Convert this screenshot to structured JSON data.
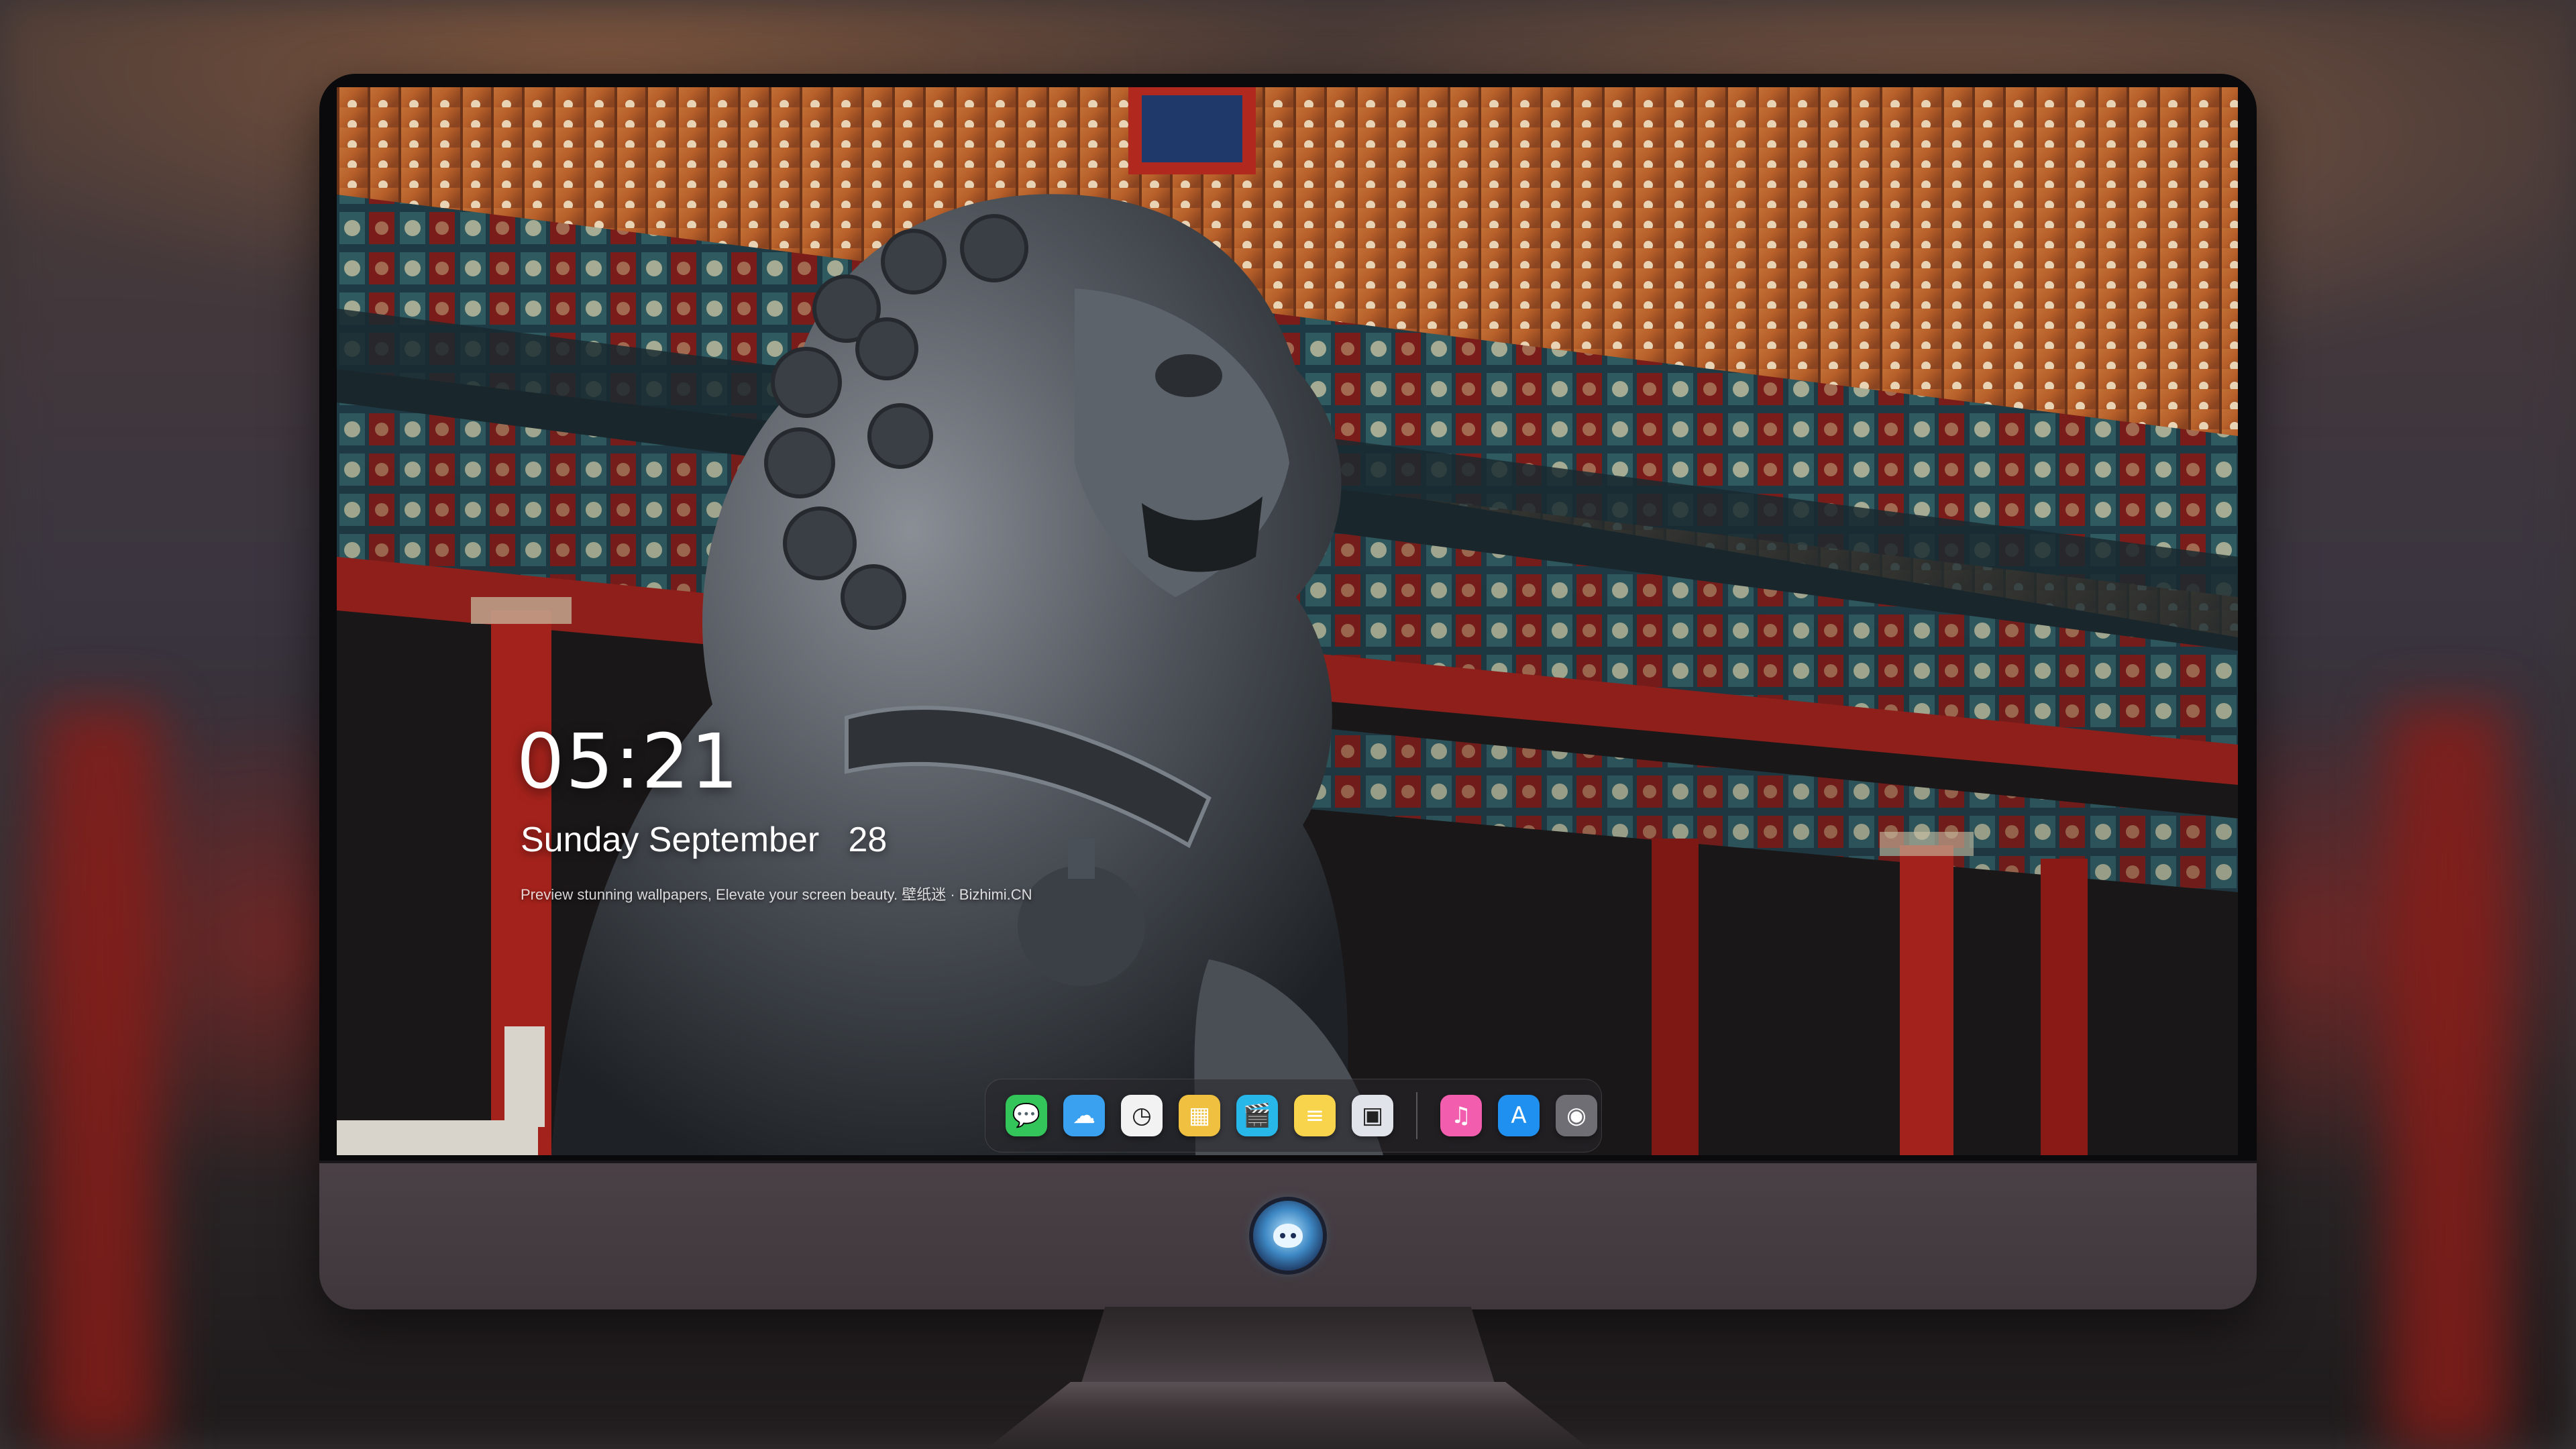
{
  "lock_screen": {
    "time": "05:21",
    "date": "Sunday September   28",
    "tagline": "Preview stunning wallpapers, Elevate your screen beauty. 壁纸迷 · Bizhimi.CN"
  },
  "dock": {
    "apps": [
      {
        "name": "messages",
        "glyph": "💬",
        "color": "#33c45a"
      },
      {
        "name": "weather",
        "glyph": "☁",
        "color": "#3aa0f0"
      },
      {
        "name": "clock",
        "glyph": "◷",
        "color": "#f2f2f2"
      },
      {
        "name": "preview",
        "glyph": "▦",
        "color": "#f0c040"
      },
      {
        "name": "clips",
        "glyph": "🎬",
        "color": "#27b7e8"
      },
      {
        "name": "notes",
        "glyph": "≡",
        "color": "#f8d44c"
      },
      {
        "name": "photo-booth",
        "glyph": "▣",
        "color": "#e0e4ea"
      },
      {
        "name": "music",
        "glyph": "♫",
        "color": "#f25dae"
      },
      {
        "name": "app-store",
        "glyph": "A",
        "color": "#1f8ff0"
      },
      {
        "name": "camera",
        "glyph": "◉",
        "color": "#6e6e74"
      }
    ]
  },
  "colors": {
    "bezel": "#0a0a0c",
    "chin": "#4a4146",
    "pillar_red": "#a4221c"
  }
}
